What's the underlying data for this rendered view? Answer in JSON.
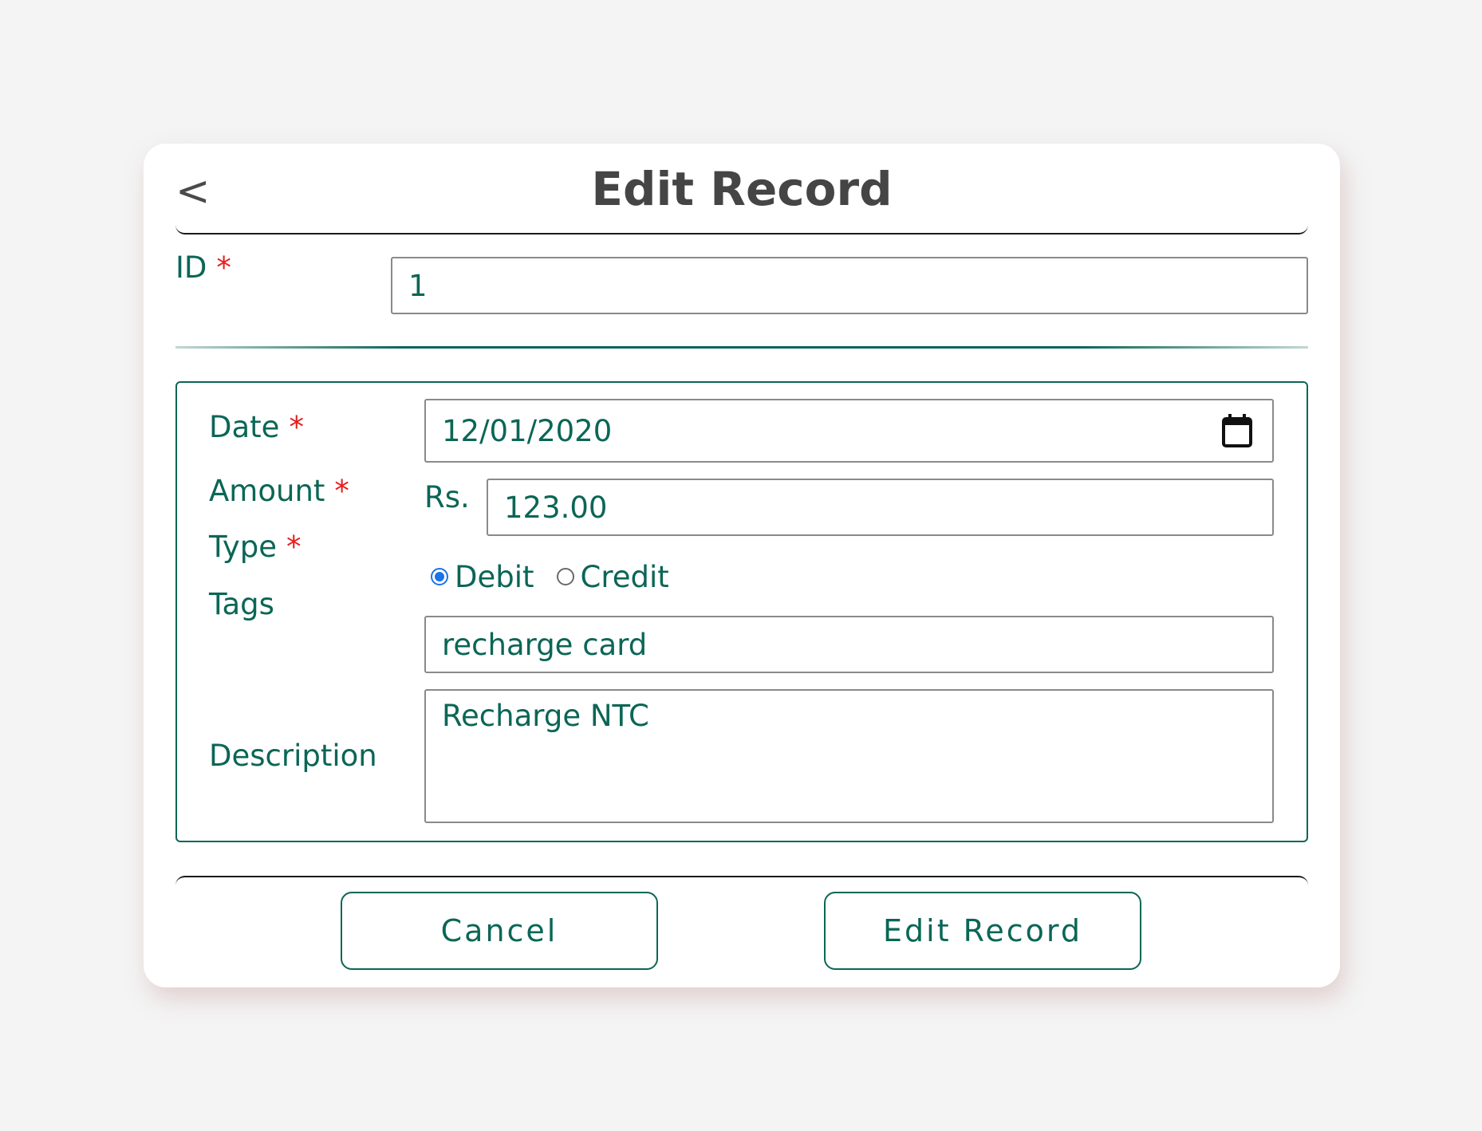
{
  "header": {
    "back_glyph": "<",
    "title": "Edit Record"
  },
  "form": {
    "id": {
      "label": "ID",
      "required_mark": "*",
      "value": "1"
    },
    "date": {
      "label": "Date",
      "required_mark": "*",
      "value": "12/01/2020",
      "icon": "calendar-icon"
    },
    "amount": {
      "label": "Amount",
      "required_mark": "*",
      "currency_prefix": "Rs.",
      "value": "123.00"
    },
    "type": {
      "label": "Type",
      "required_mark": "*",
      "options": [
        {
          "label": "Debit",
          "checked": true
        },
        {
          "label": "Credit",
          "checked": false
        }
      ]
    },
    "tags": {
      "label": "Tags",
      "value": "recharge card"
    },
    "description": {
      "label": "Description",
      "value": "Recharge NTC"
    }
  },
  "actions": {
    "cancel_label": "Cancel",
    "submit_label": "Edit Record"
  },
  "colors": {
    "accent": "#0b6656",
    "required": "#e61e1e",
    "radio_selected": "#1a73e8",
    "title": "#454545",
    "background": "#f4f4f4"
  }
}
